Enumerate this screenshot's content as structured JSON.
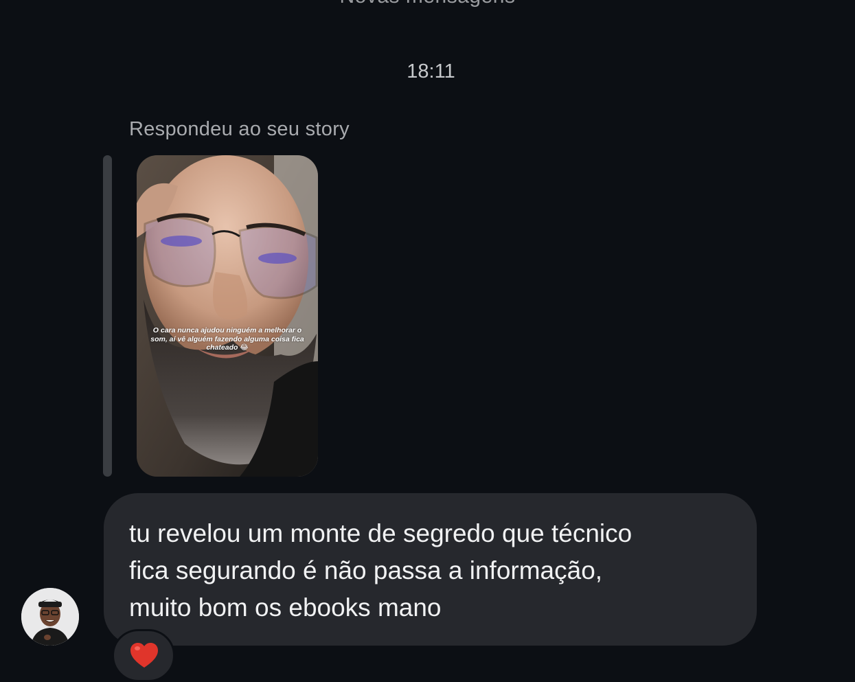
{
  "header": {
    "new_messages_label": "Novas mensagens",
    "timestamp": "18:11"
  },
  "story_reply": {
    "label": "Respondeu ao seu story",
    "caption": "O cara nunca ajudou ninguém a melhorar o som, aí vê alguém fazendo alguma coisa fica chateado 😂"
  },
  "message": {
    "text": "tu revelou um monte de segredo que técnico\nfica segurando é não passa a informação,\nmuito bom os ebooks mano"
  },
  "reaction": {
    "emoji": "red-heart-icon",
    "color": "#e0352b"
  },
  "colors": {
    "background": "#0c0f14",
    "bubble": "#26282d",
    "reply_bar": "#3a3d42"
  }
}
